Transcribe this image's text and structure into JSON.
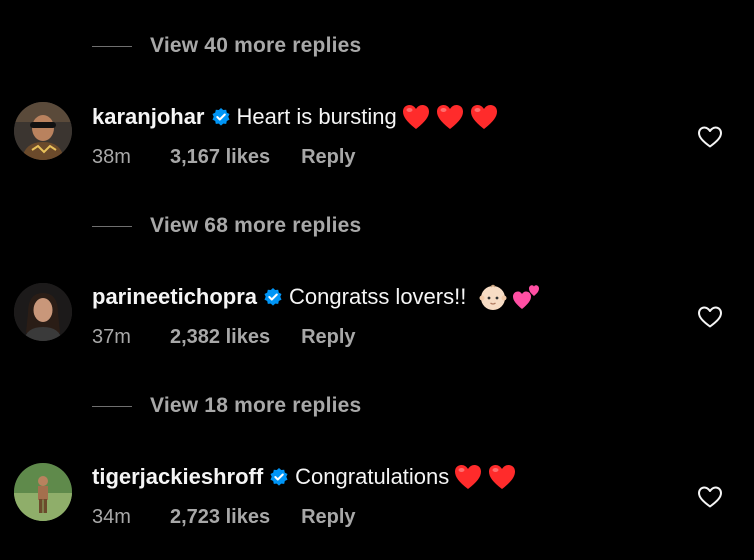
{
  "threads": [
    {
      "view_replies": "View 40 more replies"
    },
    {
      "username": "karanjohar",
      "text": "Heart is bursting",
      "emojis": [
        "red-heart",
        "red-heart",
        "red-heart"
      ],
      "time": "38m",
      "likes": "3,167 likes",
      "reply_label": "Reply",
      "view_replies": "View 68 more replies"
    },
    {
      "username": "parineetichopra",
      "text": "Congratss lovers!!",
      "emojis": [
        "baby-face",
        "two-hearts"
      ],
      "time": "37m",
      "likes": "2,382 likes",
      "reply_label": "Reply",
      "view_replies": "View 18 more replies"
    },
    {
      "username": "tigerjackieshroff",
      "text": "Congratulations",
      "emojis": [
        "red-heart",
        "red-heart"
      ],
      "time": "34m",
      "likes": "2,723 likes",
      "reply_label": "Reply"
    }
  ],
  "colors": {
    "background": "#000000",
    "primary_text": "#f5f5f5",
    "secondary_text": "#a8a8a8",
    "verified_badge": "#0095f6",
    "heart_emoji": "#ff2b2b"
  },
  "icons": {
    "verified": "verified-badge-icon",
    "like": "heart-outline-icon"
  }
}
